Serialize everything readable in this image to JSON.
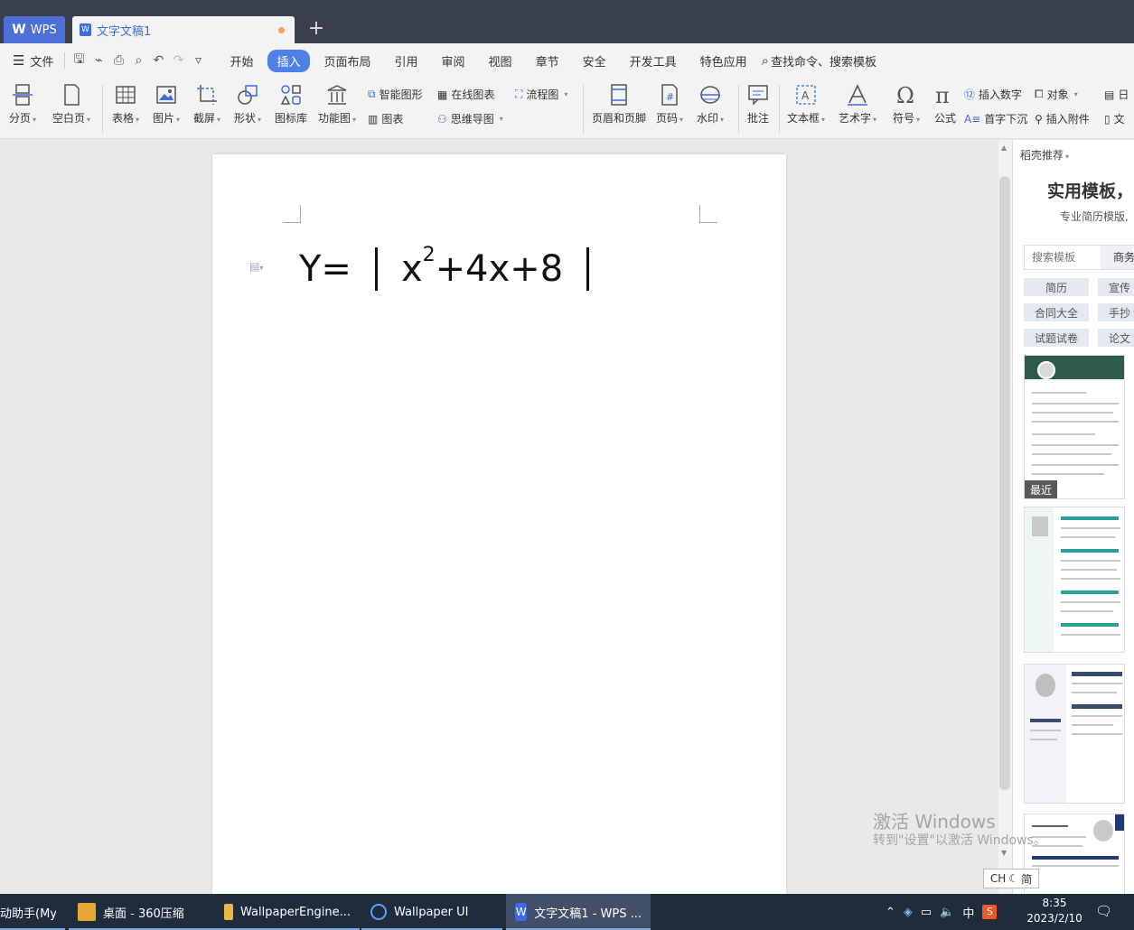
{
  "titlebar": {
    "wps_tab": "WPS",
    "doc_tab": "文字文稿1",
    "new_tab": "+"
  },
  "menubar": {
    "file": "文件",
    "items": [
      "开始",
      "插入",
      "页面布局",
      "引用",
      "审阅",
      "视图",
      "章节",
      "安全",
      "开发工具",
      "特色应用"
    ],
    "active_item": "插入",
    "search": "查找命令、搜索模板"
  },
  "ribbon": {
    "page_break": "分页",
    "blank_page": "空白页",
    "table": "表格",
    "picture": "图片",
    "screenshot": "截屏",
    "shapes": "形状",
    "icon_library": "图标库",
    "function_chart": "功能图",
    "smart_graphic": "智能图形",
    "chart": "图表",
    "online_chart": "在线图表",
    "flowchart": "流程图",
    "mind_map": "思维导图",
    "header_footer": "页眉和页脚",
    "page_number": "页码",
    "watermark": "水印",
    "comment": "批注",
    "text_box": "文本框",
    "word_art": "艺术字",
    "symbol": "符号",
    "formula": "公式",
    "insert_number": "插入数字",
    "drop_cap": "首字下沉",
    "object": "对象",
    "attachment": "插入附件",
    "date": "日",
    "doc": "文"
  },
  "document": {
    "formula_lead": "Y=",
    "formula_x": "x",
    "formula_exp": "2",
    "formula_rest": "+4x+8"
  },
  "panel": {
    "header": "稻壳推荐",
    "title": "实用模板，",
    "subtitle": "专业简历模版,",
    "search_placeholder": "搜索模板",
    "search_tab": "商务",
    "chips": [
      "简历",
      "宣传",
      "合同大全",
      "手抄",
      "试题试卷",
      "论文"
    ],
    "recent_label": "最近"
  },
  "watermark": {
    "line1": "激活 Windows",
    "line2": "转到\"设置\"以激活 Windows。"
  },
  "ime": {
    "label": "CH",
    "mode": "简"
  },
  "taskbar": {
    "items": [
      "动助手(MyE...",
      "桌面 - 360压缩",
      "WallpaperEngine...",
      "Wallpaper UI",
      "文字文稿1 - WPS ..."
    ],
    "tray_lang": "中",
    "time": "8:35",
    "date": "2023/2/10"
  },
  "colors": {
    "accent": "#4f80e8",
    "titlebar": "#3a3f4e",
    "taskbar": "#1e2c3c",
    "tab_modified_dot": "#f5a25d"
  }
}
